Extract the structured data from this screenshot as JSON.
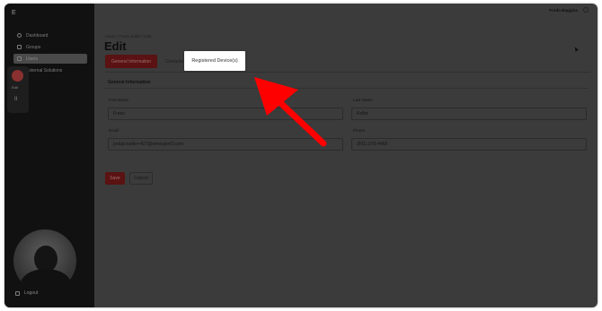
{
  "app": {
    "logo": "E"
  },
  "sidebar": {
    "items": [
      {
        "label": "Dashboard",
        "icon": "home-icon"
      },
      {
        "label": "Groups",
        "icon": "folder-icon"
      },
      {
        "label": "Users",
        "icon": "users-icon"
      },
      {
        "label": "External Solutions",
        "icon": "external-icon"
      }
    ],
    "active_item": "Users",
    "logout_label": "Logout"
  },
  "recorder": {
    "label": "Edit",
    "pause_symbol": "II"
  },
  "topbar": {
    "user_name": "Frodo Baggins"
  },
  "breadcrumb": "Users  /  Frodo Keller  /  Edit",
  "page_title": "Edit",
  "tabs": [
    {
      "label": "General Information",
      "active": true
    },
    {
      "label": "Contacts",
      "active": false
    },
    {
      "label": "Registered Device(s)",
      "highlighted": true
    }
  ],
  "section": {
    "title": "General Information",
    "fields": {
      "first_name": {
        "label": "First Name",
        "value": "Frodo"
      },
      "last_name": {
        "label": "Last Name",
        "value": "Keller"
      },
      "email": {
        "label": "Email",
        "value": "jordan.keller+427@emergent3.com"
      },
      "phone": {
        "label": "Phone",
        "value": "(801) 979-4468"
      }
    }
  },
  "buttons": {
    "save": "Save",
    "cancel": "Cancel"
  },
  "colors": {
    "overlay": "#3b3b3b",
    "sidebar": "#111111",
    "accent": "#5a1212",
    "annotation_arrow": "#ff0000"
  }
}
